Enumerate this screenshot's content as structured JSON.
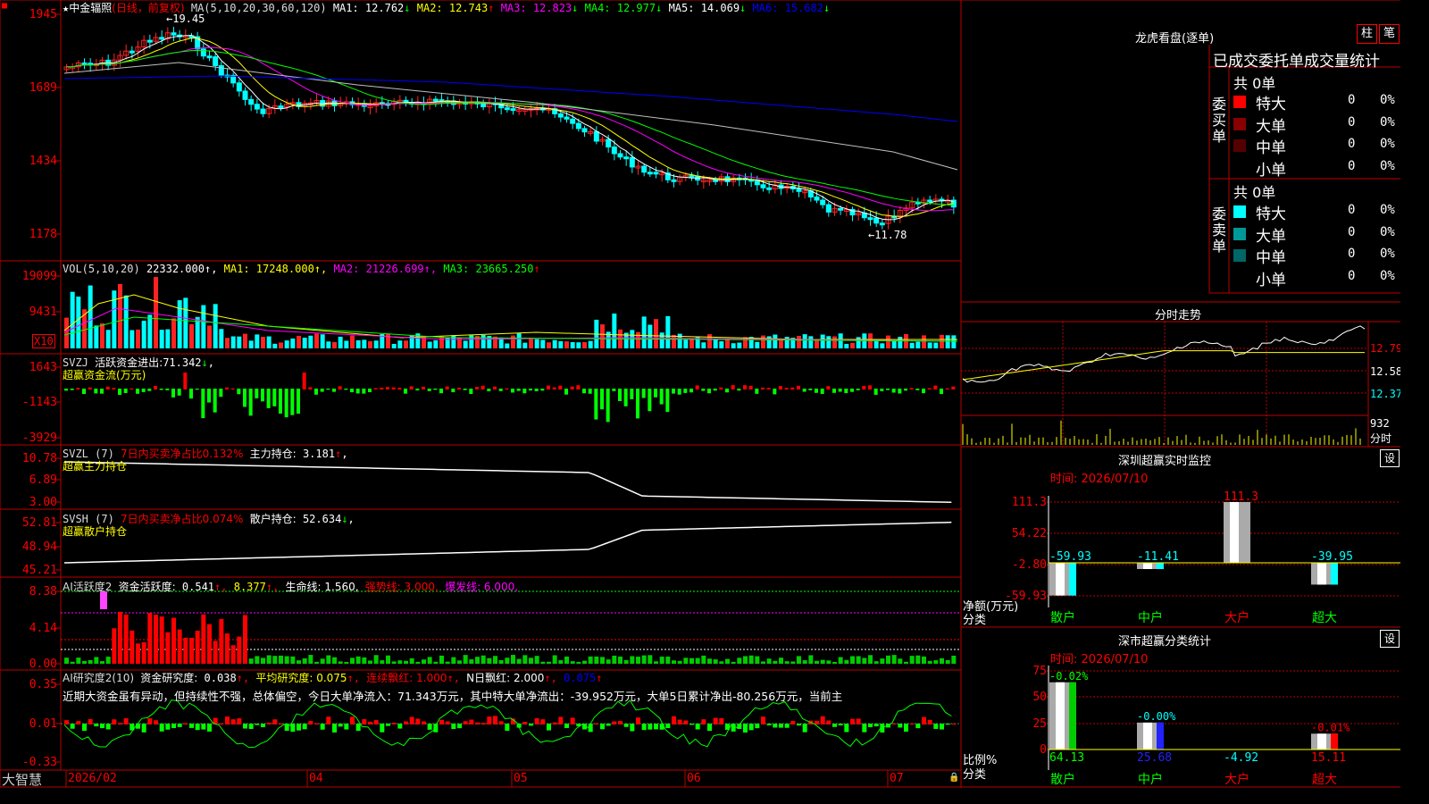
{
  "colors": {
    "up": "#ff2222",
    "down": "#00ffff",
    "grid": "#bb0000",
    "ma1": "#ffffff",
    "ma2": "#ffff00",
    "ma3": "#ff00ff",
    "ma4": "#00ff00",
    "ma5": "#c0c0c0",
    "ma6": "#0000ff"
  },
  "main": {
    "stock": "中金辐照",
    "period": "(日线，前复权)",
    "ma_prefix": "MA(5,10,20,30,60,120)",
    "mas": [
      {
        "l": "MA1:",
        "v": "12.762",
        "c": "#ffffff",
        "a": "↓"
      },
      {
        "l": "MA2:",
        "v": "12.743",
        "c": "#ffff00",
        "a": "↑"
      },
      {
        "l": "MA3:",
        "v": "12.823",
        "c": "#ff00ff",
        "a": "↓"
      },
      {
        "l": "MA4:",
        "v": "12.977",
        "c": "#00ff00",
        "a": "↓"
      },
      {
        "l": "MA5:",
        "v": "14.069",
        "c": "#ffffff",
        "a": "↓"
      },
      {
        "l": "MA6:",
        "v": "15.682",
        "c": "#0000ff",
        "a": "↓"
      }
    ],
    "yticks": [
      "1945",
      "1689",
      "1434",
      "1178"
    ],
    "high": "19.45",
    "low": "11.78"
  },
  "vol": {
    "head": "VOL(5,10,20)",
    "value": "22332.000",
    "ma1": "17248.000",
    "ma2": "21226.699",
    "ma3": "23665.250",
    "yticks": [
      "19099",
      "9431"
    ],
    "x10": "X10"
  },
  "svzj": {
    "head": "SVZJ",
    "title": "活跃资金进出:",
    "value": "71.342",
    "arrow": "↓",
    "name": "超赢资金流(万元)",
    "yticks": [
      "1643",
      "-1143",
      "-3929"
    ]
  },
  "svzl": {
    "head": "SVZL (7)",
    "ratio": "7日内买卖净占比0.132%",
    "label": "主力持仓:",
    "value": "3.181",
    "arrow": "↑",
    "name": "超赢主力持仓",
    "yticks": [
      "10.78",
      "6.89",
      "3.00"
    ]
  },
  "svsh": {
    "head": "SVSH (7)",
    "ratio": "7日内买卖净占比0.074%",
    "label": "散户持仓:",
    "value": "52.634",
    "arrow": "↓",
    "name": "超赢散户持仓",
    "yticks": [
      "52.81",
      "48.94",
      "45.21"
    ]
  },
  "ai1": {
    "head": "AI活跃度2",
    "label": "资金活跃度:",
    "v1": "0.541",
    "v2": "8.377",
    "life": "生命线: 1.560,",
    "strong": "强势线: 3.000,",
    "burst": "爆发线: 6.000,",
    "yticks": [
      "8.38",
      "4.14",
      "0.00"
    ]
  },
  "ai2": {
    "head": "AI研究度2(10)",
    "label": "资金研究度:",
    "value": "0.038",
    "avg": "平均研究度: 0.075",
    "lian": "连续飘红: 1.000",
    "nred": "N日飘红: 2.000",
    "last": "0.075",
    "summary": "近期大资金虽有异动，但持续性不强，总体偏空，今日大单净流入：71.343万元，其中特大单净流出：-39.952万元，大单5日累计净出-80.256万元，当前主",
    "yticks": [
      "0.35",
      "0.01",
      "-0.33"
    ]
  },
  "xaxis": {
    "brand": "大智慧",
    "labels": [
      "2026/02",
      "04",
      "05",
      "06",
      "07"
    ]
  },
  "lhb": {
    "title": "龙虎看盘(逐单)",
    "btns": [
      "柱",
      "笔"
    ],
    "subtitle": "已成交委托单成交量统计",
    "buy": {
      "label": "委买单",
      "total": "共 0单",
      "rows": [
        {
          "n": "特大",
          "v": "0",
          "p": "0%"
        },
        {
          "n": "大单",
          "v": "0",
          "p": "0%"
        },
        {
          "n": "中单",
          "v": "0",
          "p": "0%"
        },
        {
          "n": "小单",
          "v": "0",
          "p": "0%"
        }
      ]
    },
    "sell": {
      "label": "委卖单",
      "total": "共 0单",
      "rows": [
        {
          "n": "特大",
          "v": "0",
          "p": "0%"
        },
        {
          "n": "大单",
          "v": "0",
          "p": "0%"
        },
        {
          "n": "中单",
          "v": "0",
          "p": "0%"
        },
        {
          "n": "小单",
          "v": "0",
          "p": "0%"
        }
      ]
    }
  },
  "intraday": {
    "title": "分时走势",
    "prices": [
      "12.79",
      "12.58",
      "12.37"
    ],
    "vol": "932",
    "unit": "分时"
  },
  "sz": {
    "title": "深圳超赢实时监控",
    "btn": "设",
    "time": "时间: 2026/07/10",
    "yticks": [
      "111.3",
      "54.22",
      "-2.80",
      "-59.93"
    ],
    "ylabel": "净额(万元)",
    "cat": "分类",
    "chart_data": {
      "type": "bar",
      "categories": [
        "散户",
        "中户",
        "大户",
        "超大"
      ],
      "values": [
        -59.93,
        -11.41,
        111.3,
        -39.95
      ],
      "labels": [
        "-59.93",
        "-11.41",
        "111.3",
        "-39.95"
      ]
    }
  },
  "cls": {
    "title": "深市超赢分类统计",
    "btn": "设",
    "time": "时间: 2026/07/10",
    "yticks": [
      "75",
      "50",
      "25",
      "0"
    ],
    "ylabel": "比例%",
    "cat": "分类",
    "chart_data": {
      "type": "bar",
      "categories": [
        "散户",
        "中户",
        "大户",
        "超大"
      ],
      "values": [
        64.13,
        25.68,
        -4.92,
        15.11
      ],
      "labels": [
        "-0.02%",
        "-0.00%",
        "",
        "-0.01%"
      ],
      "bottom": [
        "64.13",
        "25.68",
        "-4.92",
        "15.11"
      ]
    }
  }
}
